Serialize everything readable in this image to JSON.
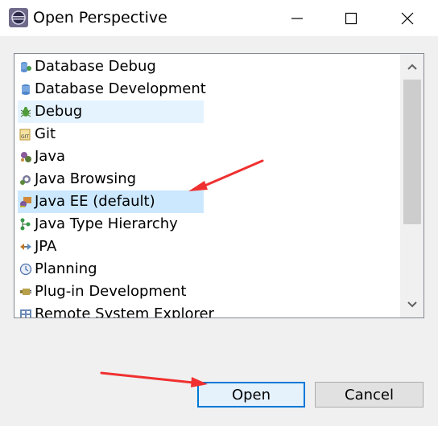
{
  "window": {
    "title": "Open Perspective",
    "controls": {
      "minimize": "minimize-icon",
      "maximize": "maximize-icon",
      "close": "close-icon"
    }
  },
  "perspective_list": {
    "items": [
      {
        "label": "Database Debug",
        "icon": "database-debug-icon",
        "state": "normal"
      },
      {
        "label": "Database Development",
        "icon": "database-development-icon",
        "state": "normal"
      },
      {
        "label": "Debug",
        "icon": "bug-icon",
        "state": "hover"
      },
      {
        "label": "Git",
        "icon": "git-icon",
        "state": "normal"
      },
      {
        "label": "Java",
        "icon": "java-icon",
        "state": "normal"
      },
      {
        "label": "Java Browsing",
        "icon": "java-browsing-icon",
        "state": "normal"
      },
      {
        "label": "Java EE (default)",
        "icon": "java-ee-icon",
        "state": "selected"
      },
      {
        "label": "Java Type Hierarchy",
        "icon": "type-hierarchy-icon",
        "state": "normal"
      },
      {
        "label": "JPA",
        "icon": "jpa-icon",
        "state": "normal"
      },
      {
        "label": "Planning",
        "icon": "planning-icon",
        "state": "normal"
      },
      {
        "label": "Plug-in Development",
        "icon": "plugin-icon",
        "state": "normal"
      },
      {
        "label": "Remote System Explorer",
        "icon": "remote-system-icon",
        "state": "normal"
      }
    ]
  },
  "buttons": {
    "open_label": "Open",
    "cancel_label": "Cancel"
  },
  "colors": {
    "selection": "#cce8ff",
    "hover": "#e5f3ff",
    "default_button_border": "#0078d7",
    "annotation_arrow": "#f03030"
  }
}
